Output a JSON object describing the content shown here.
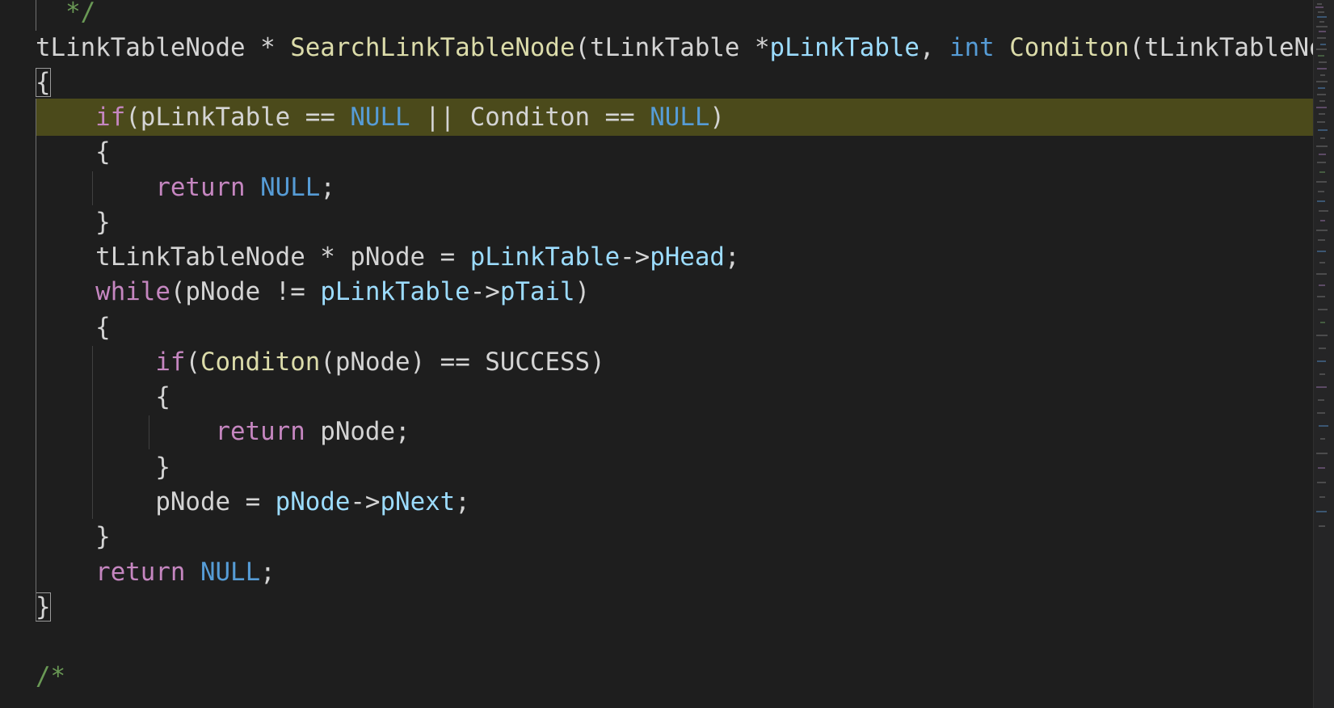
{
  "editor": {
    "theme_colors": {
      "background": "#1e1e1e",
      "keyword": "#c586c0",
      "builtin": "#569cd6",
      "function": "#dcdcaa",
      "variable": "#9cdcfe",
      "comment": "#6a9955",
      "text": "#d4d4d4",
      "line_highlight": "#4b4a1b"
    },
    "lines": [
      {
        "tokens": [
          {
            "t": "  */",
            "c": "cm"
          }
        ]
      },
      {
        "tokens": [
          {
            "t": "tLinkTableNode * ",
            "c": "txt"
          },
          {
            "t": "SearchLinkTableNode",
            "c": "fn"
          },
          {
            "t": "(tLinkTable *",
            "c": "txt"
          },
          {
            "t": "pLinkTable",
            "c": "var"
          },
          {
            "t": ", ",
            "c": "txt"
          },
          {
            "t": "int",
            "c": "blue"
          },
          {
            "t": " ",
            "c": "txt"
          },
          {
            "t": "Conditon",
            "c": "fn"
          },
          {
            "t": "(tLinkTableNode",
            "c": "txt"
          }
        ]
      },
      {
        "tokens": [
          {
            "t": "{",
            "c": "txt",
            "box": true
          }
        ]
      },
      {
        "highlight": true,
        "tokens": [
          {
            "t": "    ",
            "c": "txt"
          },
          {
            "t": "if",
            "c": "kw"
          },
          {
            "t": "(pLinkTable == ",
            "c": "txt"
          },
          {
            "t": "NULL",
            "c": "blue"
          },
          {
            "t": " || Conditon == ",
            "c": "txt"
          },
          {
            "t": "NULL",
            "c": "blue"
          },
          {
            "t": ")",
            "c": "txt"
          }
        ]
      },
      {
        "tokens": [
          {
            "t": "    {",
            "c": "txt"
          }
        ]
      },
      {
        "tokens": [
          {
            "t": "        ",
            "c": "txt"
          },
          {
            "t": "return",
            "c": "kw"
          },
          {
            "t": " ",
            "c": "txt"
          },
          {
            "t": "NULL",
            "c": "blue"
          },
          {
            "t": ";",
            "c": "txt"
          }
        ]
      },
      {
        "tokens": [
          {
            "t": "    }",
            "c": "txt"
          }
        ]
      },
      {
        "tokens": [
          {
            "t": "    tLinkTableNode * pNode = ",
            "c": "txt"
          },
          {
            "t": "pLinkTable",
            "c": "var"
          },
          {
            "t": "->",
            "c": "txt"
          },
          {
            "t": "pHead",
            "c": "var"
          },
          {
            "t": ";",
            "c": "txt"
          }
        ]
      },
      {
        "tokens": [
          {
            "t": "    ",
            "c": "txt"
          },
          {
            "t": "while",
            "c": "kw"
          },
          {
            "t": "(pNode != ",
            "c": "txt"
          },
          {
            "t": "pLinkTable",
            "c": "var"
          },
          {
            "t": "->",
            "c": "txt"
          },
          {
            "t": "pTail",
            "c": "var"
          },
          {
            "t": ")",
            "c": "txt"
          }
        ]
      },
      {
        "tokens": [
          {
            "t": "    {",
            "c": "txt"
          }
        ]
      },
      {
        "tokens": [
          {
            "t": "        ",
            "c": "txt"
          },
          {
            "t": "if",
            "c": "kw"
          },
          {
            "t": "(",
            "c": "txt"
          },
          {
            "t": "Conditon",
            "c": "fn"
          },
          {
            "t": "(pNode) == SUCCESS)",
            "c": "txt"
          }
        ]
      },
      {
        "tokens": [
          {
            "t": "        {",
            "c": "txt"
          }
        ]
      },
      {
        "tokens": [
          {
            "t": "            ",
            "c": "txt"
          },
          {
            "t": "return",
            "c": "kw"
          },
          {
            "t": " pNode;",
            "c": "txt"
          }
        ]
      },
      {
        "tokens": [
          {
            "t": "        }",
            "c": "txt"
          }
        ]
      },
      {
        "tokens": [
          {
            "t": "        pNode = ",
            "c": "txt"
          },
          {
            "t": "pNode",
            "c": "var"
          },
          {
            "t": "->",
            "c": "txt"
          },
          {
            "t": "pNext",
            "c": "var"
          },
          {
            "t": ";",
            "c": "txt"
          }
        ]
      },
      {
        "tokens": [
          {
            "t": "    }",
            "c": "txt"
          }
        ]
      },
      {
        "tokens": [
          {
            "t": "    ",
            "c": "txt"
          },
          {
            "t": "return",
            "c": "kw"
          },
          {
            "t": " ",
            "c": "txt"
          },
          {
            "t": "NULL",
            "c": "blue"
          },
          {
            "t": ";",
            "c": "txt"
          }
        ]
      },
      {
        "tokens": [
          {
            "t": "}",
            "c": "txt",
            "box": true
          }
        ]
      },
      {
        "tokens": [
          {
            "t": "",
            "c": "txt"
          }
        ]
      },
      {
        "tokens": [
          {
            "t": "/*",
            "c": "cm"
          }
        ]
      }
    ]
  }
}
